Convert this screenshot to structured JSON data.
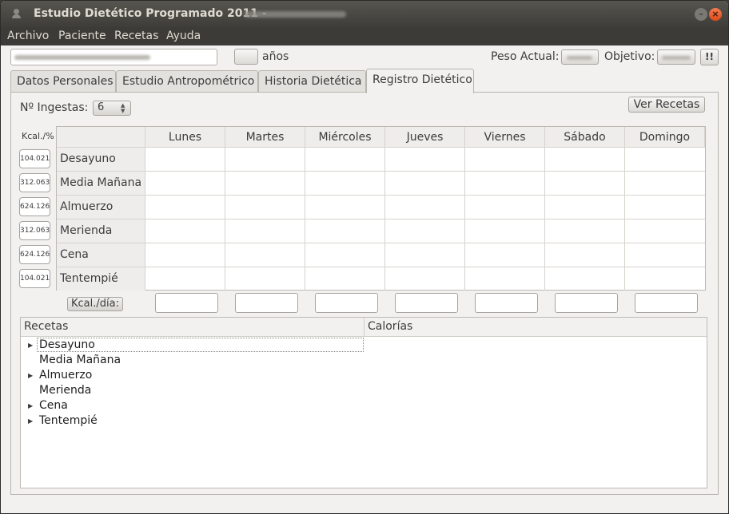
{
  "window": {
    "title": "Estudio Dietético Programado 2011 -"
  },
  "menu": [
    "Archivo",
    "Paciente",
    "Recetas",
    "Ayuda"
  ],
  "patient": {
    "anos_label": "años",
    "peso_actual_label": "Peso Actual:",
    "objetivo_label": "Objetivo:",
    "alert_button": "!!"
  },
  "tabs": [
    {
      "label": "Datos Personales",
      "active": false
    },
    {
      "label": "Estudio Antropométrico",
      "active": false
    },
    {
      "label": "Historia Dietética",
      "active": false
    },
    {
      "label": "Registro Dietético",
      "active": true
    }
  ],
  "registro": {
    "ingestas_label": "Nº Ingestas:",
    "ingestas_value": "6",
    "ver_recetas": "Ver Recetas",
    "kcal_pct_header": "Kcal./%",
    "days": [
      "Lunes",
      "Martes",
      "Miércoles",
      "Jueves",
      "Viernes",
      "Sábado",
      "Domingo"
    ],
    "meals": [
      {
        "name": "Desayuno",
        "kcal": "104.021"
      },
      {
        "name": "Media Mañana",
        "kcal": "312.063"
      },
      {
        "name": "Almuerzo",
        "kcal": "624.126"
      },
      {
        "name": "Merienda",
        "kcal": "312.063"
      },
      {
        "name": "Cena",
        "kcal": "624.126"
      },
      {
        "name": "Tentempié",
        "kcal": "104.021"
      }
    ],
    "kcal_dia_label": "Kcal./día:"
  },
  "tree": {
    "col_recetas": "Recetas",
    "col_calorias": "Calorías",
    "items": [
      {
        "label": "Desayuno",
        "expandable": true
      },
      {
        "label": "Media Mañana",
        "expandable": false
      },
      {
        "label": "Almuerzo",
        "expandable": true
      },
      {
        "label": "Merienda",
        "expandable": false
      },
      {
        "label": "Cena",
        "expandable": true
      },
      {
        "label": "Tentempié",
        "expandable": true
      }
    ]
  },
  "icons": {
    "app": "person-icon",
    "minimize": "minimize-icon",
    "close": "close-icon",
    "expander": "triangle-right-icon",
    "spin": "spin-arrows-icon"
  }
}
